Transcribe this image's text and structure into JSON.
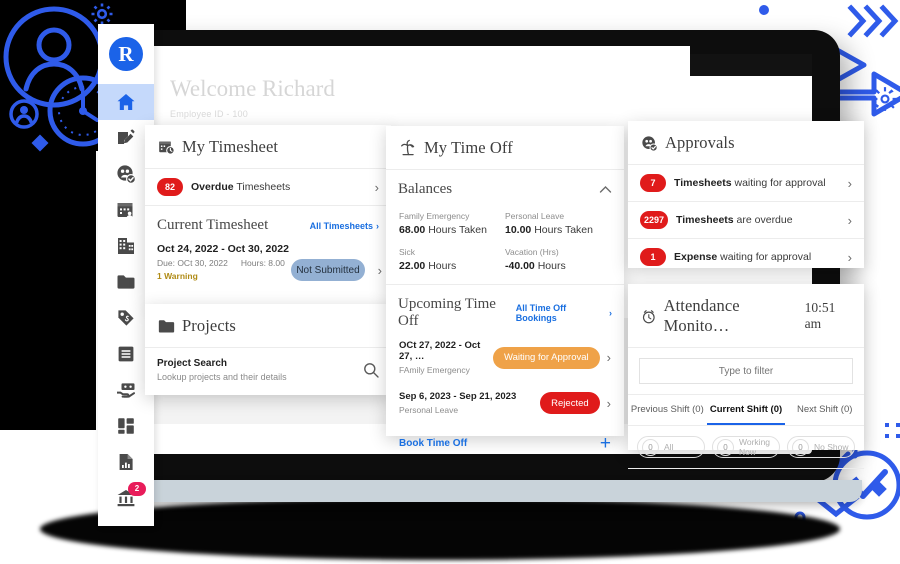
{
  "brand": {
    "logo_letter": "R",
    "accent": "#1b63e8"
  },
  "sidebar": {
    "items": [
      {
        "icon": "home-icon",
        "name": "home",
        "badge": null
      },
      {
        "icon": "timesheet-edit-icon",
        "name": "timesheets",
        "badge": null
      },
      {
        "icon": "people-check-icon",
        "name": "approvals",
        "badge": null
      },
      {
        "icon": "calendar-person-icon",
        "name": "schedule",
        "badge": null
      },
      {
        "icon": "building-icon",
        "name": "organization",
        "badge": null
      },
      {
        "icon": "folder-icon",
        "name": "projects",
        "badge": null
      },
      {
        "icon": "price-tag-icon",
        "name": "billing",
        "badge": null
      },
      {
        "icon": "list-icon",
        "name": "lists",
        "badge": null
      },
      {
        "icon": "cash-hand-icon",
        "name": "expenses",
        "badge": null
      },
      {
        "icon": "dashboard-grid-icon",
        "name": "dashboards",
        "badge": null
      },
      {
        "icon": "report-document-icon",
        "name": "reports",
        "badge": null
      },
      {
        "icon": "bank-icon",
        "name": "payroll",
        "badge": "2"
      }
    ]
  },
  "page": {
    "greeting": "Welcome Richard",
    "employee_id": "Employee ID - 100",
    "ghost_section": "Projects"
  },
  "timesheet_card": {
    "icon": "calendar-clock-icon",
    "title": "My Timesheet",
    "overdue": {
      "count": "82",
      "bold": "Overdue",
      "rest": " Timesheets",
      "chevron": "›"
    },
    "current": {
      "heading": "Current Timesheet",
      "link": "All Timesheets",
      "link_chevron": "›",
      "dates": "Oct 24, 2022 - Oct 30, 2022",
      "due": "Due: OCt 30, 2022",
      "hours": "Hours: 8.00",
      "warning": "1 Warning",
      "status": "Not Submitted",
      "status_color": "#93b0d3",
      "chevron": "›"
    }
  },
  "projects_card": {
    "icon": "folder-icon",
    "title": "Projects",
    "search_title": "Project Search",
    "search_sub": "Lookup projects and their details",
    "search_icon": "search-icon"
  },
  "timeoff_card": {
    "icon": "palm-tree-icon",
    "title": "My Time Off",
    "balances": {
      "heading": "Balances",
      "collapse_icon": "chevron-up-icon",
      "items": [
        {
          "label": "Family Emergency",
          "value": "68.00",
          "unit": "Hours Taken"
        },
        {
          "label": "Personal Leave",
          "value": "10.00",
          "unit": "Hours Taken"
        },
        {
          "label": "Sick",
          "value": "22.00",
          "unit": "Hours"
        },
        {
          "label": "Vacation (Hrs)",
          "value": "-40.00",
          "unit": "Hours"
        }
      ]
    },
    "upcoming": {
      "heading": "Upcoming Time Off",
      "link": "All Time Off Bookings",
      "link_chevron": "›",
      "items": [
        {
          "dates": "OCt 27, 2022 - Oct 27, …",
          "type": "FAmily Emergency",
          "status": "Waiting for Approval",
          "status_color": "#efa248",
          "chevron": "›"
        },
        {
          "dates": "Sep 6, 2023 - Sep 21, 2023",
          "type": "Personal Leave",
          "status": "Rejected",
          "status_color": "#e01b1b",
          "chevron": "›"
        }
      ],
      "book_label": "Book Time Off",
      "book_plus": "+"
    }
  },
  "approvals_card": {
    "icon": "people-check-icon",
    "title": "Approvals",
    "rows": [
      {
        "count": "7",
        "bold": "Timesheets",
        "rest": " waiting for approval",
        "chevron": "›"
      },
      {
        "count": "2297",
        "bold": "Timesheets",
        "rest": " are overdue",
        "chevron": "›"
      },
      {
        "count": "1",
        "bold": "Expense",
        "rest": " waiting for approval",
        "chevron": "›"
      }
    ]
  },
  "attendance_card": {
    "icon": "alarm-clock-icon",
    "title": "Attendance Monito…",
    "time": "10:51 am",
    "filter_placeholder": "Type to filter",
    "filter_value": "",
    "tabs": [
      {
        "label": "Previous Shift (0)",
        "active": false
      },
      {
        "label": "Current Shift (0)",
        "active": true
      },
      {
        "label": "Next Shift (0)",
        "active": false
      }
    ],
    "counters": [
      {
        "count": "0",
        "label": "All"
      },
      {
        "count": "0",
        "label": "Working Now"
      },
      {
        "count": "0",
        "label": "No Show"
      }
    ]
  },
  "decorations": {
    "color": "#2f5bea",
    "items": [
      "person-circle-icon",
      "clock-icon",
      "small-person-icon",
      "gear-icon",
      "diamond-icon",
      "arrow-right-icon",
      "chevrons-right-icon",
      "clock-check-icon",
      "chevrons-down-icon",
      "lock-icon",
      "sparkle-icon",
      "dot-icon"
    ]
  }
}
